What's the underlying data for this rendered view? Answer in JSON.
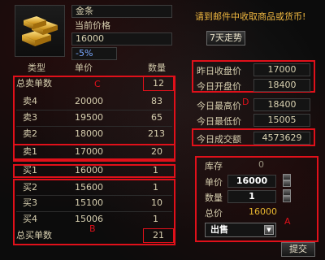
{
  "item": {
    "icon": "gold-bars-icon",
    "name": "金条",
    "price_label": "当前价格",
    "price_value": "16000",
    "change": "-5%"
  },
  "notice": "请到邮件中收取商品或货币!",
  "trend_button": "7天走势",
  "table": {
    "headers": [
      "类型",
      "单价",
      "数量"
    ],
    "sell_total_label": "总卖单数",
    "sell_total_value": "12",
    "sell_orders": [
      {
        "type": "卖4",
        "price": "20000",
        "qty": "83"
      },
      {
        "type": "卖3",
        "price": "19500",
        "qty": "65"
      },
      {
        "type": "卖2",
        "price": "18000",
        "qty": "213"
      },
      {
        "type": "卖1",
        "price": "17000",
        "qty": "20"
      }
    ],
    "buy_orders": [
      {
        "type": "买1",
        "price": "16000",
        "qty": "1"
      },
      {
        "type": "买2",
        "price": "15600",
        "qty": "1"
      },
      {
        "type": "买3",
        "price": "15100",
        "qty": "10"
      },
      {
        "type": "买4",
        "price": "15006",
        "qty": "1"
      }
    ],
    "buy_total_label": "总买单数",
    "buy_total_value": "21"
  },
  "stats": [
    {
      "label": "昨日收盘价",
      "value": "17000"
    },
    {
      "label": "今日开盘价",
      "value": "18400"
    },
    {
      "label": "今日最高价",
      "value": "18400"
    },
    {
      "label": "今日最低价",
      "value": "15005"
    },
    {
      "label": "今日成交额",
      "value": "4573629"
    }
  ],
  "trade": {
    "stock_label": "库存",
    "stock_value": "0",
    "unit_price_label": "单价",
    "unit_price_value": "16000",
    "quantity_label": "数量",
    "quantity_value": "1",
    "total_label": "总价",
    "total_value": "16000",
    "mode": "出售",
    "submit": "提交"
  },
  "markers": {
    "A": "A",
    "B": "B",
    "C": "C",
    "D": "D"
  },
  "colors": {
    "highlight": "#e0101a",
    "accent": "#7aa8ff",
    "gold": "#e8b830"
  }
}
